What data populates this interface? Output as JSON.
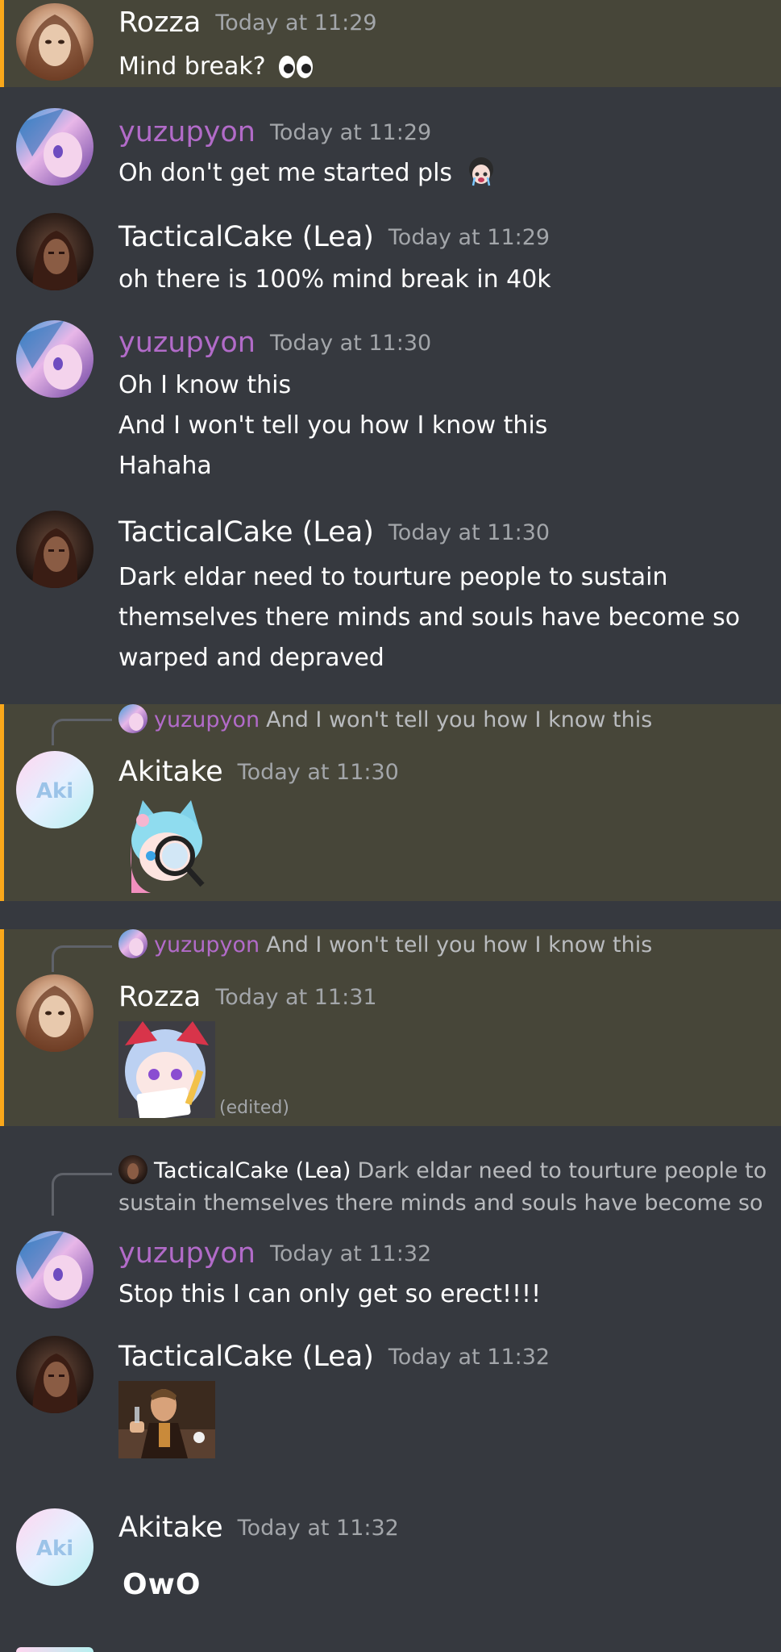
{
  "colors": {
    "background": "#36393f",
    "highlight": "#474639",
    "highlight_bar": "#faa81a",
    "username_purple": "#b26bc9",
    "timestamp": "#a3a6aa"
  },
  "messages": [
    {
      "author": "Rozza",
      "time": "Today at 11:29",
      "lines": [
        "Mind break?"
      ],
      "emoji": "eyes-emoji"
    },
    {
      "author": "yuzupyon",
      "time": "Today at 11:29",
      "lines": [
        "Oh don't get me started pls"
      ],
      "emoji": "crying-anime-girl-emoji"
    },
    {
      "author": "TacticalCake (Lea)",
      "time": "Today at 11:29",
      "lines": [
        "oh there is 100% mind break in 40k"
      ]
    },
    {
      "author": "yuzupyon",
      "time": "Today at 11:30",
      "lines": [
        "Oh I know this",
        "And I won't tell you how I know this",
        "Hahaha"
      ]
    },
    {
      "author": "TacticalCake (Lea)",
      "time": "Today at 11:30",
      "lines": [
        "Dark eldar need to tourture people to sustain",
        "themselves there minds and souls have become so",
        "warped and depraved"
      ]
    },
    {
      "reply_to": {
        "author": "yuzupyon",
        "text": "And I won't tell you how I know this"
      },
      "author": "Akitake",
      "time": "Today at 11:30",
      "avatar_text": "Aki",
      "sticker": "anime-cat-girl-magnifying-glass-sticker"
    },
    {
      "reply_to": {
        "author": "yuzupyon",
        "text": "And I won't tell you how I know this"
      },
      "author": "Rozza",
      "time": "Today at 11:31",
      "sticker": "anime-girl-writing-note-sticker",
      "edited": "(edited)"
    },
    {
      "reply_to": {
        "author": "TacticalCake (Lea)",
        "text_line1": "Dark eldar need to tourture people to",
        "text_line2": "sustain themselves there minds and souls have become so"
      },
      "author": "yuzupyon",
      "time": "Today at 11:32",
      "lines": [
        "Stop this I can only get so erect!!!!"
      ]
    },
    {
      "author": "TacticalCake (Lea)",
      "time": "Today at 11:32",
      "sticker": "leonardo-laughing-meme-image"
    },
    {
      "author": "Akitake",
      "time": "Today at 11:32",
      "avatar_text": "Aki",
      "lines": [
        "OwO"
      ]
    }
  ]
}
